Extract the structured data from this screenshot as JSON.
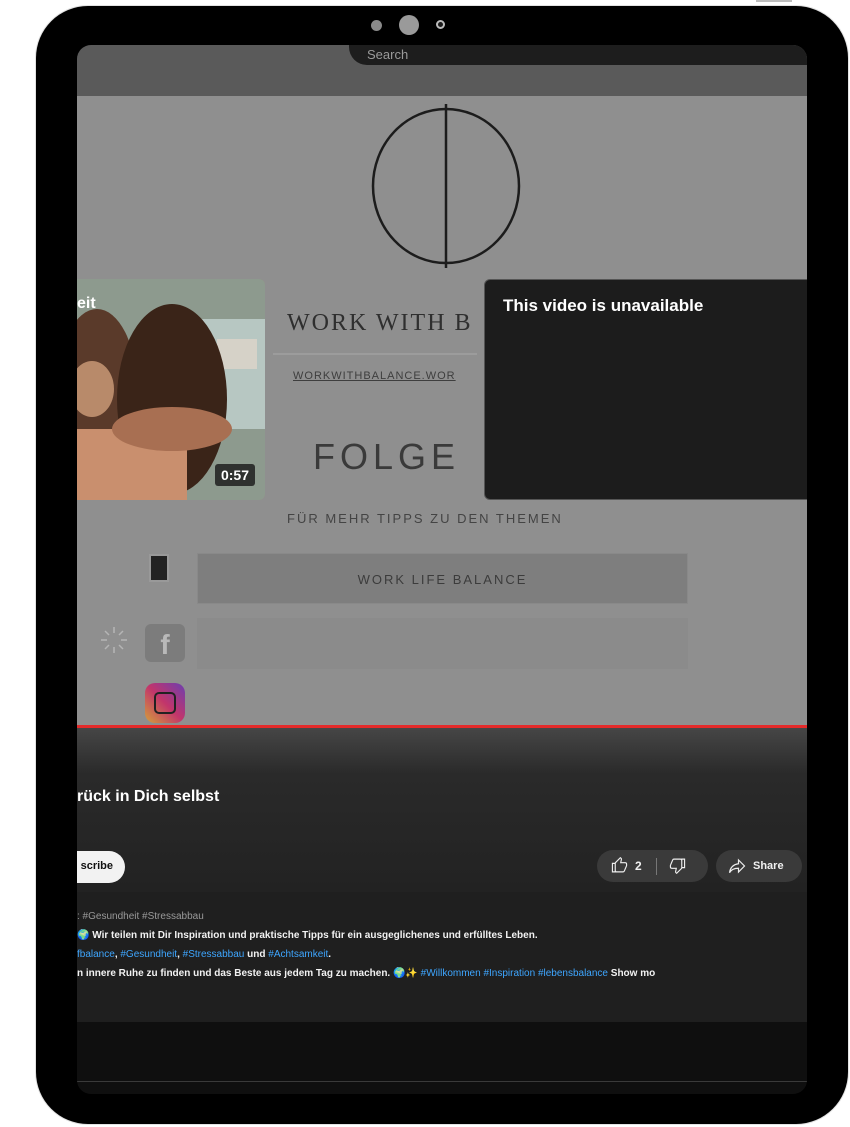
{
  "header": {
    "search_placeholder": "Search"
  },
  "video": {
    "brand_text": "WORK WITH B",
    "website": "WORKWITHBALANCE.WOR",
    "follow_heading": "FOLGE",
    "subheading": "FÜR MEHR TIPPS ZU DEN THEMEN",
    "topic_button": "WORK LIFE BALANCE",
    "social_icons": [
      "qr-code-icon",
      "facebook-icon",
      "instagram-icon"
    ],
    "progress_color": "#e42a2a"
  },
  "end_screen": {
    "left_card": {
      "title": "eit",
      "duration": "0:57"
    },
    "right_card": {
      "message": "This video is unavailable"
    }
  },
  "info": {
    "title": "rück in Dich selbst",
    "subscribe_label": "scribe",
    "likes": "2",
    "share_label": "Share"
  },
  "description": {
    "line1": ": #Gesundheit #Stressabbau",
    "line2": "Wir teilen mit Dir  Inspiration und praktische Tipps für ein ausgeglichenes und erfülltes Leben.",
    "line3_tags": [
      "fbalance",
      "#Gesundheit",
      "#Stressabbau",
      "#Achtsamkeit"
    ],
    "line3_joiners": [
      ", ",
      ", ",
      " und ",
      "."
    ],
    "line4_text": "n innere Ruhe zu finden und das Beste aus jedem Tag zu machen.",
    "line4_emoji": "🌍✨",
    "line4_tags": "#Willkommen #Inspiration #lebensbalance",
    "show_more": "Show mo"
  }
}
